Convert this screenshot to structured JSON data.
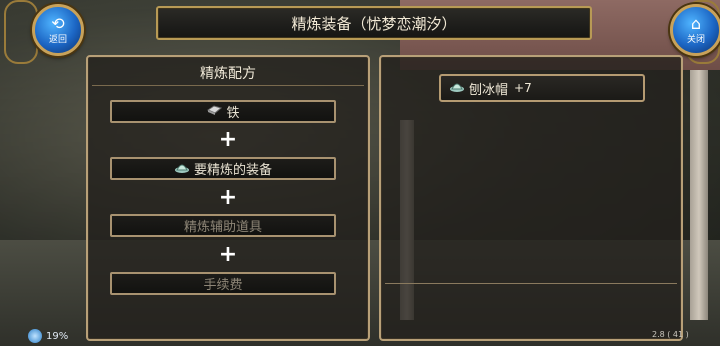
{
  "topbar": {
    "title": "精炼装备（忧梦恋潮汐）"
  },
  "buttons": {
    "back": {
      "label": "返回",
      "icon": "back-arrow-icon"
    },
    "close": {
      "label": "关闭",
      "icon": "home-icon"
    }
  },
  "recipe": {
    "title": "精炼配方",
    "slots": [
      {
        "label": "铁",
        "icon": "iron-ingot-icon"
      },
      {
        "label": "要精炼的装备",
        "icon": "equipment-hat-icon"
      },
      {
        "label": "精炼辅助道具"
      },
      {
        "label": "手续费"
      }
    ],
    "plus": "+"
  },
  "equipment": {
    "name": "刨冰帽",
    "level": "+7",
    "icon": "equipment-hat-icon"
  },
  "status": {
    "battery": "19%",
    "coords": "2.8 ( 41 )"
  },
  "colors": {
    "accent_gold": "#b89a55",
    "button_blue": "#1c66c4"
  }
}
